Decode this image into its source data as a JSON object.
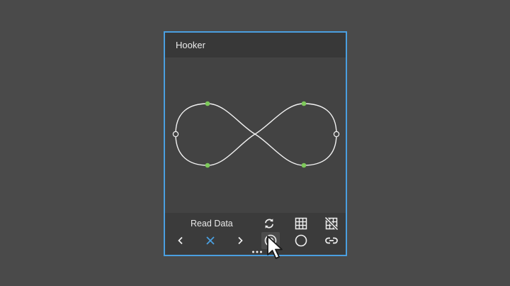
{
  "panel": {
    "title": "Hooker"
  },
  "toolbar": {
    "read_label": "Read Data",
    "buttons": {
      "prev": "chevron-left-icon",
      "clear": "x-icon",
      "next": "chevron-right-icon",
      "refresh": "refresh-icon",
      "grid": "grid-icon",
      "grid_off": "grid-off-icon",
      "point_filled": "filled-circle-icon",
      "point_empty": "empty-circle-icon",
      "link": "link-icon",
      "more": "more-icon"
    }
  },
  "colors": {
    "background": "#4a4a4a",
    "panel_border": "#4a9fe0",
    "panel_header": "#383838",
    "panel_body": "#434343",
    "toolbar": "#3b3b3b",
    "curve": "#f2f2f2",
    "handle": "#7dc95a",
    "accent_x": "#4a9fe0"
  }
}
